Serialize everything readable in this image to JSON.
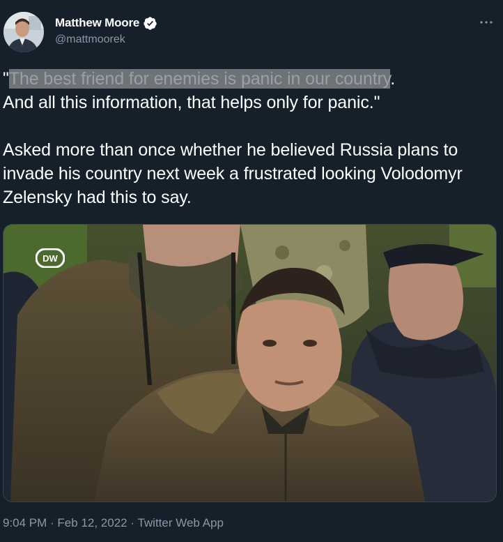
{
  "author": {
    "name": "Matthew Moore",
    "handle": "@mattmoorek"
  },
  "tweet": {
    "quote_open": "\"",
    "highlighted": "The best friend for enemies is panic in our country",
    "line1_rest": ".",
    "line2": "And all this information, that helps only for panic.\"",
    "paragraph2": "Asked more than once whether he believed Russia plans to invade his country next week a frustrated looking Volodomyr Zelensky had this to say."
  },
  "media": {
    "watermark": "DW"
  },
  "meta": {
    "time": "9:04 PM",
    "separator1": " · ",
    "date": "Feb 12, 2022",
    "separator2": " · ",
    "source": "Twitter Web App"
  },
  "icons": {
    "more": "more-horizontal-icon",
    "verified": "verified-badge-icon"
  },
  "colors": {
    "background": "#15202b",
    "secondary_text": "#8b98a5",
    "verified": "#ffffff",
    "highlight": "#6e7378"
  }
}
